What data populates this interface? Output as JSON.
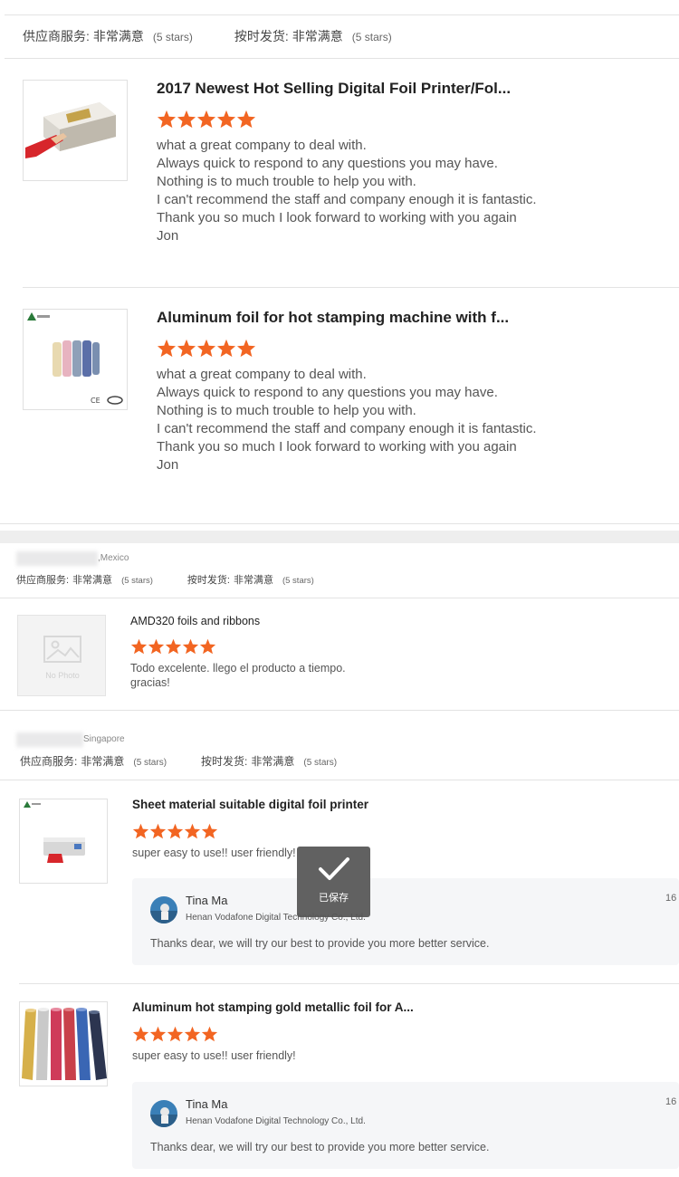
{
  "colors": {
    "star": "#f26522",
    "divider": "#e3e3e3",
    "reply_bg": "#f5f6f8"
  },
  "top_rating": {
    "service_label": "供应商服务:",
    "service_value": "非常满意",
    "service_stars": "(5 stars)",
    "ship_label": "按时发货:",
    "ship_value": "非常满意",
    "ship_stars": "(5 stars)"
  },
  "reviews_a": [
    {
      "title": "2017 Newest Hot Selling Digital Foil Printer/Fol...",
      "rating": 5,
      "text": "what a great company to deal with.\nAlways quick to respond to any questions you may have.\nNothing is to much trouble to help you with.\nI can't recommend the staff and company enough it is fantastic.\nThank you so much I look forward to working with you again\nJon",
      "thumb_icon": "foil-printer-image"
    },
    {
      "title": "Aluminum foil for hot stamping machine with f...",
      "rating": 5,
      "text": "what a great company to deal with.\nAlways quick to respond to any questions you may have.\nNothing is to much trouble to help you with.\nI can't recommend the staff and company enough it is fantastic.\nThank you so much I look forward to working with you again\nJon",
      "thumb_icon": "foil-rolls-image"
    }
  ],
  "mexico": {
    "location": ",Mexico",
    "service_label": "供应商服务:",
    "service_value": "非常满意",
    "service_stars": "(5 stars)",
    "ship_label": "按时发货:",
    "ship_value": "非常满意",
    "ship_stars": "(5 stars)",
    "title": "AMD320 foils and ribbons",
    "rating": 5,
    "text": "Todo excelente.  llego el producto a tiempo.\ngracias!",
    "no_photo": "No Photo"
  },
  "singapore": {
    "location": "Singapore",
    "service_label": "供应商服务:",
    "service_value": "非常满意",
    "service_stars": "(5 stars)",
    "ship_label": "按时发货:",
    "ship_value": "非常满意",
    "ship_stars": "(5 stars)",
    "items": [
      {
        "title": "Sheet material suitable digital foil printer",
        "rating": 5,
        "text": "super easy to use!! user friendly!",
        "reply_name": "Tina Ma",
        "reply_company": "Henan Vodafone Digital Technology Co., Ltd.",
        "reply_text": "Thanks dear, we will try our best to provide you more better service.",
        "reply_date": "16"
      },
      {
        "title": "Aluminum hot stamping gold metallic foil for A...",
        "rating": 5,
        "text": "super easy to use!! user friendly!",
        "reply_name": "Tina Ma",
        "reply_company": "Henan Vodafone Digital Technology Co., Ltd.",
        "reply_text": "Thanks dear, we will try our best to provide you more better service.",
        "reply_date": "16"
      }
    ]
  },
  "toast": {
    "text": "已保存",
    "icon": "checkmark-icon"
  }
}
